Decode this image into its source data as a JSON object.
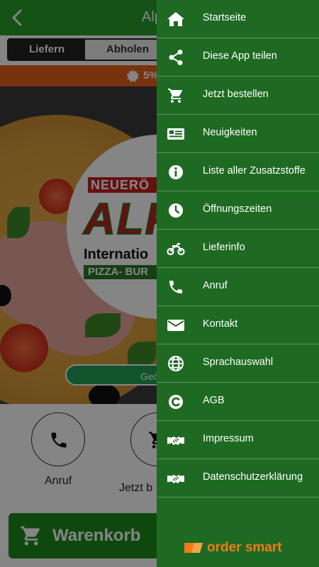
{
  "header": {
    "title": "Alp",
    "back_icon": "chevron-left-icon"
  },
  "order_mode": {
    "options": [
      "Liefern",
      "Abholen"
    ],
    "selected": "Liefern"
  },
  "promo": {
    "icon": "badge-icon",
    "text": "5%"
  },
  "logo": {
    "top": "NEUERÖ",
    "big": "ALP",
    "subtitle": "Internatio",
    "bar": "PIZZA- BUR"
  },
  "status_pill": {
    "text": "Geö"
  },
  "actions": [
    {
      "label": "Anruf",
      "icon": "phone-icon"
    },
    {
      "label": "Jetzt b",
      "icon": "cart-icon"
    }
  ],
  "cart_button": {
    "label": "Warenkorb",
    "icon": "cart-icon"
  },
  "menu": {
    "items": [
      {
        "label": "Startseite",
        "icon": "home-icon"
      },
      {
        "label": "Diese App teilen",
        "icon": "share-icon"
      },
      {
        "label": "Jetzt bestellen",
        "icon": "cart-icon"
      },
      {
        "label": "Neuigkeiten",
        "icon": "newspaper-icon"
      },
      {
        "label": "Liste aller Zusatzstoffe",
        "icon": "info-icon"
      },
      {
        "label": "Öffnungszeiten",
        "icon": "clock-icon"
      },
      {
        "label": "Lieferinfo",
        "icon": "motorcycle-icon"
      },
      {
        "label": "Anruf",
        "icon": "phone-icon"
      },
      {
        "label": "Kontakt",
        "icon": "envelope-icon"
      },
      {
        "label": "Sprachauswahl",
        "icon": "globe-icon"
      },
      {
        "label": "AGB",
        "icon": "copyright-icon"
      },
      {
        "label": "Impressum",
        "icon": "handshake-icon"
      },
      {
        "label": "Datenschutzerklärung",
        "icon": "handshake-icon"
      }
    ]
  },
  "brand": {
    "text": "order smart",
    "icon": "ordersmart-logo-icon"
  },
  "colors": {
    "drawer": "#1e6a22",
    "topbar": "#2a9d2a",
    "promo": "#e8601c",
    "brand": "#f07a1a"
  }
}
